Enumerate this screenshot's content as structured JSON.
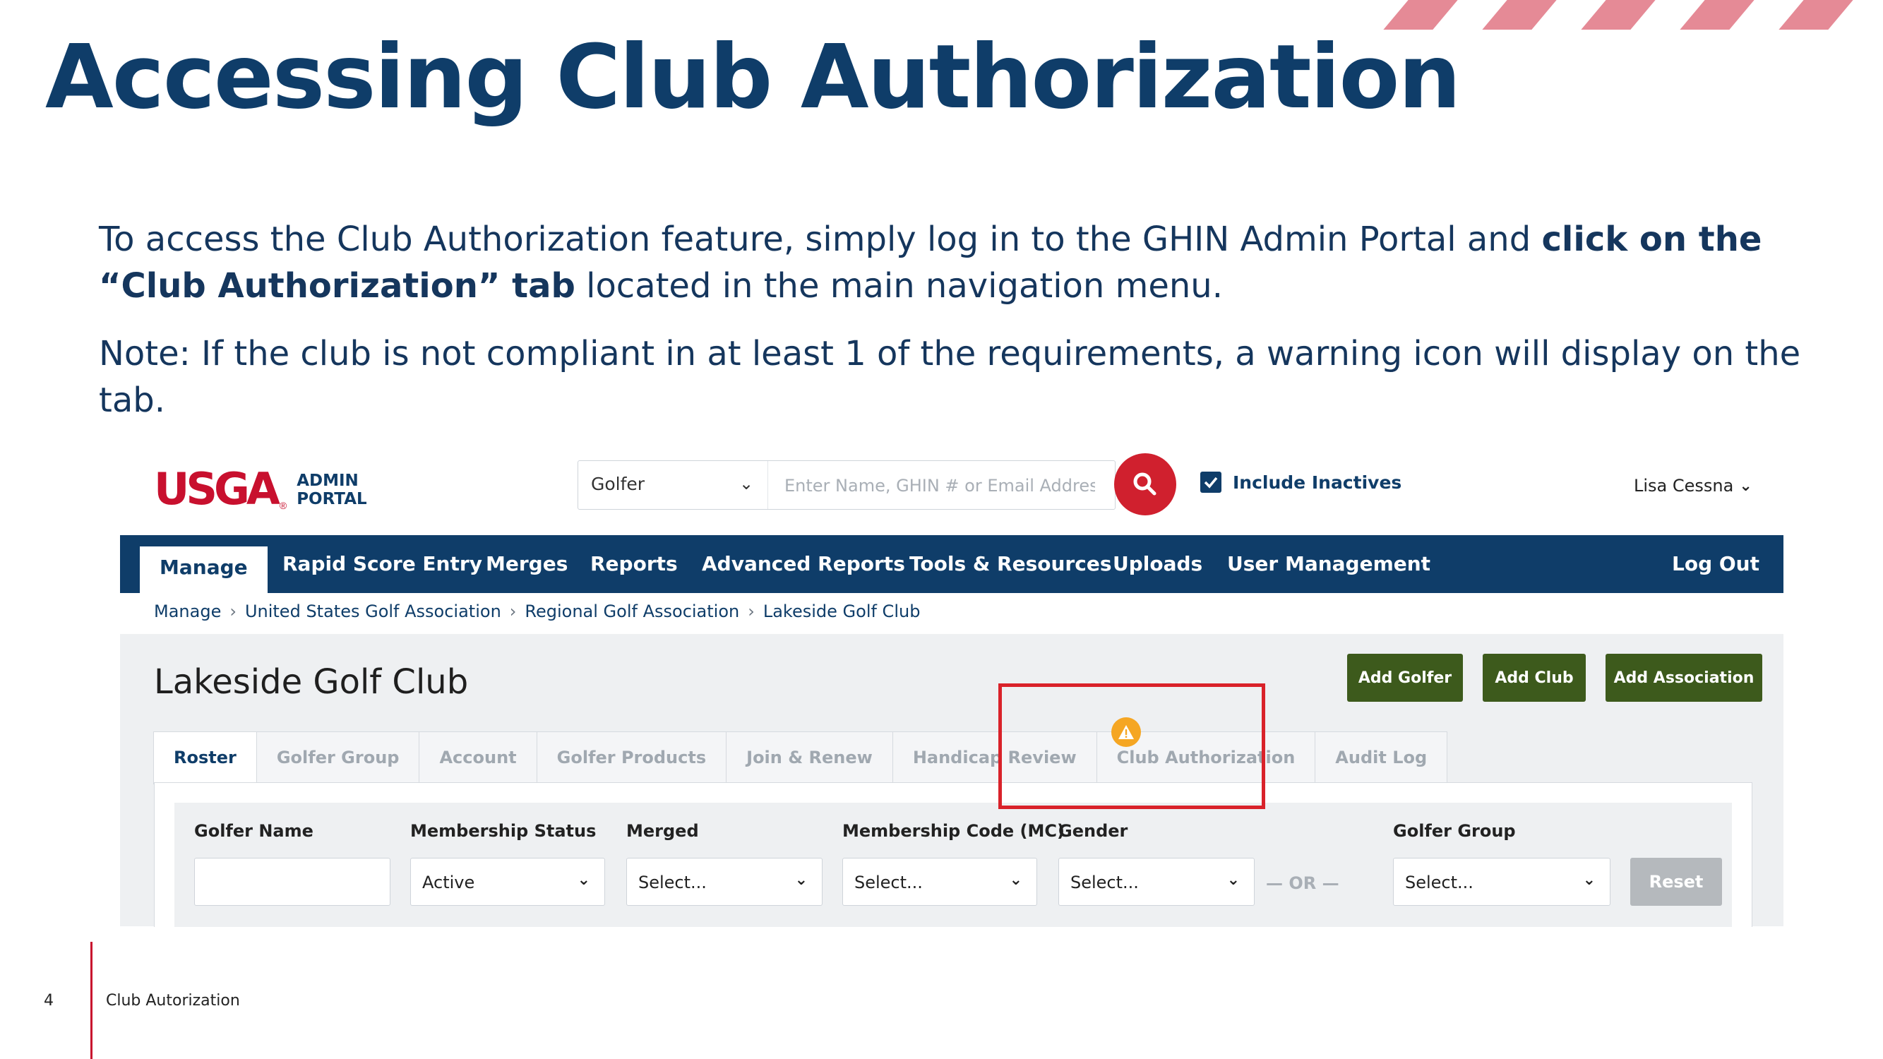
{
  "slide": {
    "title": "Accessing Club Authorization",
    "para1_pre": "To access the Club Authorization feature, simply log in to the GHIN Admin Portal and ",
    "para1_bold": "click on the “Club Authorization” tab",
    "para1_post": " located in the main navigation menu.",
    "para2": "Note: If the club is not compliant in at least 1 of the requirements, a warning icon will display on the tab.",
    "page_number": "4",
    "footer": "Club Autorization",
    "accent_color": "#e58a96"
  },
  "portal": {
    "logo": {
      "mark": "USGA",
      "registered": "®",
      "line1": "ADMIN",
      "line2": "PORTAL"
    },
    "search": {
      "type": "Golfer",
      "placeholder": "Enter Name, GHIN # or Email Address",
      "icon": "search-icon"
    },
    "include_inactives": {
      "label": "Include Inactives",
      "checked": true
    },
    "user": "Lisa Cessna",
    "nav": {
      "items": [
        "Manage",
        "Rapid Score Entry",
        "Merges",
        "Reports",
        "Advanced Reports",
        "Tools & Resources",
        "Uploads",
        "User Management"
      ],
      "active": "Manage",
      "logout": "Log Out"
    },
    "breadcrumb": [
      "Manage",
      "United States Golf Association",
      "Regional Golf Association",
      "Lakeside Golf Club"
    ],
    "club_name": "Lakeside Golf Club",
    "actions": [
      "Add Golfer",
      "Add Club",
      "Add Association"
    ],
    "tabs": [
      "Roster",
      "Golfer Group",
      "Account",
      "Golfer Products",
      "Join & Renew",
      "Handicap Review",
      "Club Authorization",
      "Audit Log"
    ],
    "active_tab": "Roster",
    "warning_tab": "Club Authorization",
    "filters": {
      "golfer_name": {
        "label": "Golfer Name",
        "value": ""
      },
      "membership_status": {
        "label": "Membership Status",
        "value": "Active"
      },
      "merged": {
        "label": "Merged",
        "value": "Select..."
      },
      "membership_code": {
        "label": "Membership Code (MC)",
        "value": "Select..."
      },
      "gender": {
        "label": "Gender",
        "value": "Select..."
      },
      "or": "— OR —",
      "golfer_group": {
        "label": "Golfer Group",
        "value": "Select..."
      },
      "reset": "Reset"
    },
    "colors": {
      "navy": "#0f3d69",
      "red": "#d0202e",
      "green": "#3d5a1c",
      "warning": "#f5a623",
      "highlight": "#d9222a"
    }
  }
}
